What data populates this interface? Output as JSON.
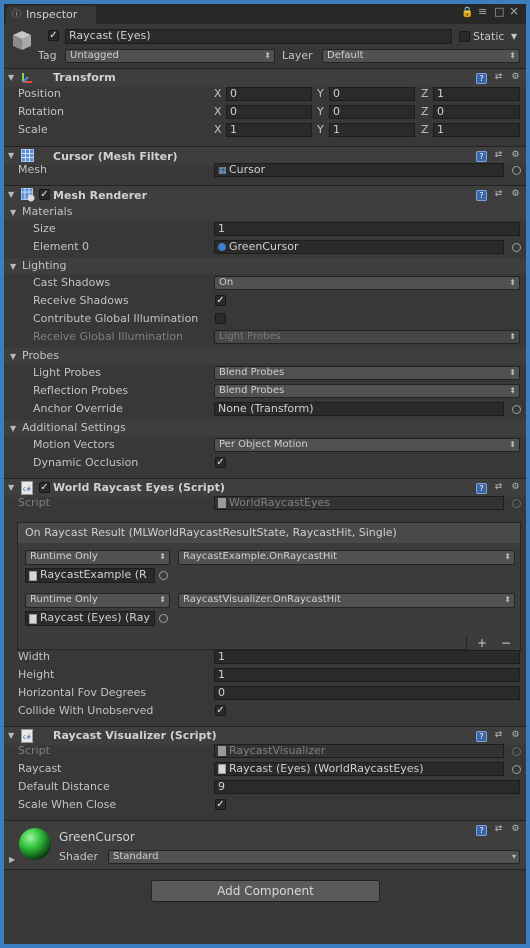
{
  "tab": {
    "title": "Inspector"
  },
  "object": {
    "name": "Raycast (Eyes)",
    "static_label": "Static",
    "tag_label": "Tag",
    "tag_value": "Untagged",
    "layer_label": "Layer",
    "layer_value": "Default"
  },
  "transform": {
    "title": "Transform",
    "position": {
      "label": "Position",
      "x": "0",
      "y": "0",
      "z": "1"
    },
    "rotation": {
      "label": "Rotation",
      "x": "0",
      "y": "0",
      "z": "0"
    },
    "scale": {
      "label": "Scale",
      "x": "1",
      "y": "1",
      "z": "1"
    },
    "x_label": "X",
    "y_label": "Y",
    "z_label": "Z"
  },
  "mesh_filter": {
    "title": "Cursor (Mesh Filter)",
    "mesh_label": "Mesh",
    "mesh_value": "Cursor"
  },
  "mesh_renderer": {
    "title": "Mesh Renderer",
    "materials": {
      "label": "Materials",
      "size_label": "Size",
      "size_value": "1",
      "element_label": "Element 0",
      "element_value": "GreenCursor"
    },
    "lighting": {
      "label": "Lighting",
      "cast_shadows_label": "Cast Shadows",
      "cast_shadows_value": "On",
      "receive_shadows_label": "Receive Shadows",
      "contribute_gi_label": "Contribute Global Illumination",
      "receive_gi_label": "Receive Global Illumination",
      "receive_gi_value": "Light Probes"
    },
    "probes": {
      "label": "Probes",
      "light_probes_label": "Light Probes",
      "light_probes_value": "Blend Probes",
      "reflection_probes_label": "Reflection Probes",
      "reflection_probes_value": "Blend Probes",
      "anchor_label": "Anchor Override",
      "anchor_value": "None (Transform)"
    },
    "additional": {
      "label": "Additional Settings",
      "motion_vectors_label": "Motion Vectors",
      "motion_vectors_value": "Per Object Motion",
      "dynamic_occlusion_label": "Dynamic Occlusion"
    }
  },
  "world_raycast": {
    "title": "World Raycast Eyes (Script)",
    "script_label": "Script",
    "script_value": "WorldRaycastEyes",
    "event_title": "On Raycast Result (MLWorldRaycastResultState, RaycastHit, Single)",
    "listeners": [
      {
        "mode": "Runtime Only",
        "function": "RaycastExample.OnRaycastHit",
        "target": "RaycastExample (R"
      },
      {
        "mode": "Runtime Only",
        "function": "RaycastVisualizer.OnRaycastHit",
        "target": "Raycast (Eyes) (Ray"
      }
    ],
    "plus": "+",
    "minus": "−",
    "width_label": "Width",
    "width_value": "1",
    "height_label": "Height",
    "height_value": "1",
    "fov_label": "Horizontal Fov Degrees",
    "fov_value": "0",
    "collide_label": "Collide With Unobserved"
  },
  "raycast_visualizer": {
    "title": "Raycast Visualizer (Script)",
    "script_label": "Script",
    "script_value": "RaycastVisualizer",
    "raycast_label": "Raycast",
    "raycast_value": "Raycast (Eyes) (WorldRaycastEyes)",
    "distance_label": "Default Distance",
    "distance_value": "9",
    "scale_label": "Scale When Close"
  },
  "material": {
    "name": "GreenCursor",
    "shader_label": "Shader",
    "shader_value": "Standard"
  },
  "add_component": "Add Component",
  "colors": {
    "background": "#383838",
    "header": "#3e3e3e",
    "field": "#2a2a2a",
    "accent": "#3b7fc0",
    "green_material": "#2fbf3a"
  }
}
